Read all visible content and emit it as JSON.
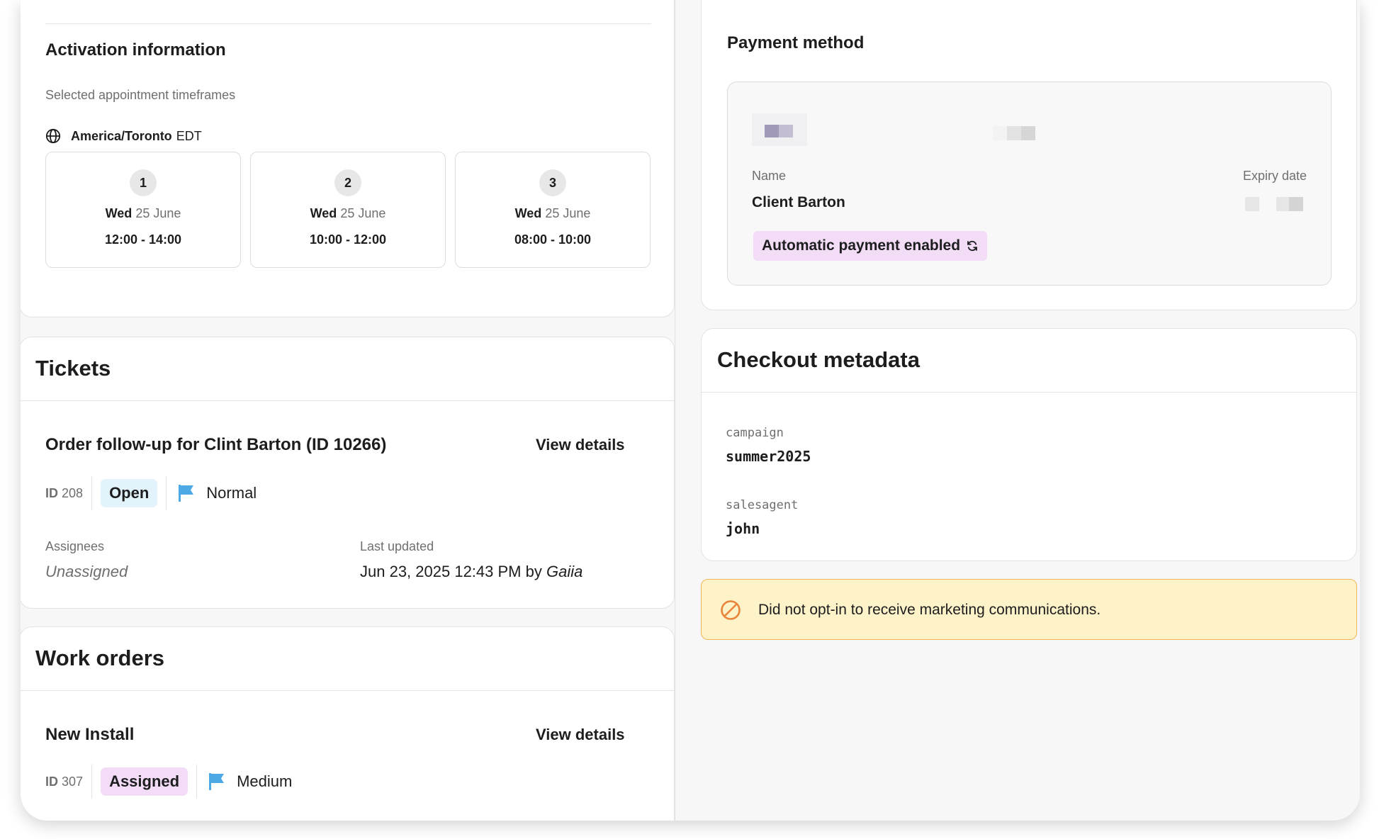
{
  "activation": {
    "title": "Activation information",
    "timeframes_label": "Selected appointment timeframes",
    "timezone_name": "America/Toronto",
    "timezone_abbr": "EDT",
    "slots": [
      {
        "number": "1",
        "day": "Wed",
        "date": "25 June",
        "time": "12:00 - 14:00"
      },
      {
        "number": "2",
        "day": "Wed",
        "date": "25 June",
        "time": "10:00 - 12:00"
      },
      {
        "number": "3",
        "day": "Wed",
        "date": "25 June",
        "time": "08:00 - 10:00"
      }
    ]
  },
  "tickets": {
    "title": "Tickets",
    "item": {
      "name": "Order follow-up for Clint Barton (ID 10266)",
      "view_label": "View details",
      "id_prefix": "ID",
      "id": "208",
      "status": "Open",
      "priority": "Normal",
      "assignees_label": "Assignees",
      "assignees_value": "Unassigned",
      "updated_label": "Last updated",
      "updated_value": "Jun 23, 2025 12:43 PM by",
      "updated_by": "Gaiia"
    }
  },
  "work_orders": {
    "title": "Work orders",
    "item": {
      "name": "New Install",
      "view_label": "View details",
      "id_prefix": "ID",
      "id": "307",
      "status": "Assigned",
      "priority": "Medium"
    }
  },
  "payment": {
    "title": "Payment method",
    "name_label": "Name",
    "name_value": "Client Barton",
    "expiry_label": "Expiry date",
    "auto_badge": "Automatic payment enabled"
  },
  "checkout": {
    "title": "Checkout metadata",
    "fields": [
      {
        "key": "campaign",
        "value": "summer2025"
      },
      {
        "key": "salesagent",
        "value": "john"
      }
    ]
  },
  "marketing_alert": {
    "text": "Did not opt-in to receive marketing communications."
  },
  "colors": {
    "flag": "#4da9e6",
    "alert_icon": "#e8853a",
    "badge_open": "#e3f3fb",
    "badge_assigned": "#f2dcf6",
    "alert_bg": "#fdf2c8"
  }
}
